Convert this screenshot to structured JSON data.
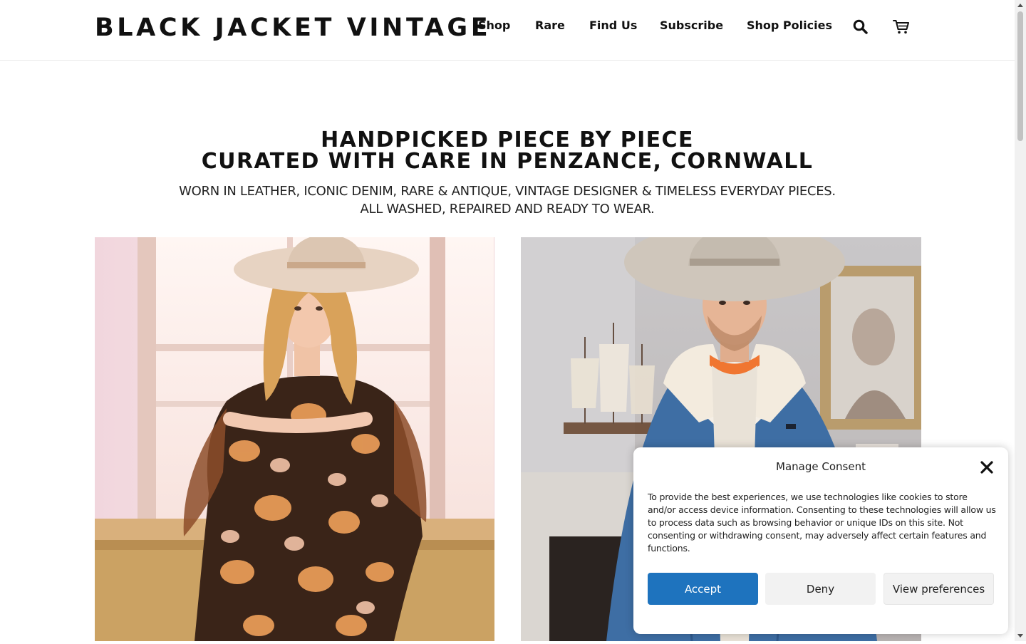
{
  "header": {
    "brand": "BLACK JACKET VINTAGE",
    "nav": [
      {
        "label": "Shop"
      },
      {
        "label": "Rare"
      },
      {
        "label": "Find Us"
      },
      {
        "label": "Subscribe"
      },
      {
        "label": "Shop Policies"
      }
    ],
    "icons": {
      "search": "search-icon",
      "cart": "cart-icon"
    }
  },
  "hero": {
    "title_line1": "HANDPICKED PIECE BY PIECE",
    "title_line2": "CURATED WITH CARE IN PENZANCE, CORNWALL",
    "subtitle_line1": "WORN IN LEATHER, ICONIC DENIM, RARE & ANTIQUE, VINTAGE DESIGNER & TIMELESS EVERYDAY PIECES.",
    "subtitle_line2": "ALL WASHED, REPAIRED AND READY TO WEAR."
  },
  "images": [
    {
      "name": "woman-floral-dress-photo"
    },
    {
      "name": "man-denim-jacket-photo"
    }
  ],
  "consent": {
    "title": "Manage Consent",
    "body": "To provide the best experiences, we use technologies like cookies to store and/or access device information. Consenting to these technologies will allow us to process data such as browsing behavior or unique IDs on this site. Not consenting or withdrawing consent, may adversely affect certain features and functions.",
    "accept_label": "Accept",
    "deny_label": "Deny",
    "prefs_label": "View preferences"
  },
  "colors": {
    "accent": "#1e73be",
    "text": "#111111",
    "button_secondary": "#f2f2f2"
  }
}
